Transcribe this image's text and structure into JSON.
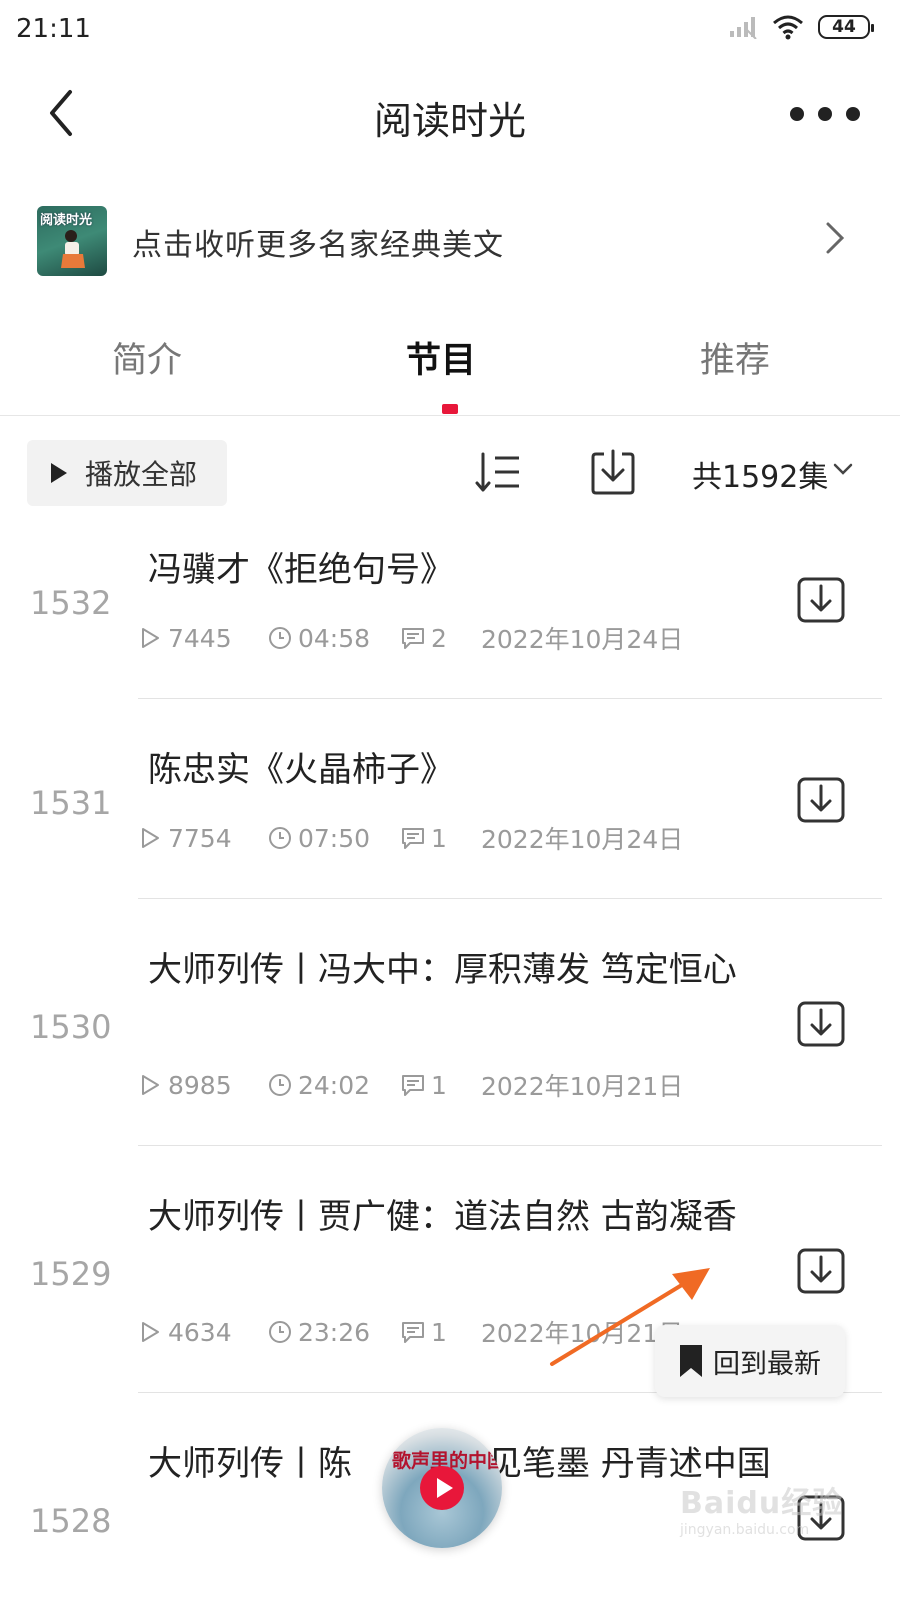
{
  "status_bar": {
    "time": "21:11",
    "battery": "44"
  },
  "header": {
    "title": "阅读时光"
  },
  "promo": {
    "cover_text": "阅读时光",
    "text": "点击收听更多名家经典美文"
  },
  "tabs": [
    {
      "label": "简介",
      "active": false
    },
    {
      "label": "节目",
      "active": true
    },
    {
      "label": "推荐",
      "active": false
    }
  ],
  "toolbar": {
    "play_all_label": "播放全部",
    "count_label": "共1592集"
  },
  "episodes": [
    {
      "num": "1532",
      "title": "冯骥才《拒绝句号》",
      "plays": "7445",
      "duration": "04:58",
      "comments": "2",
      "date": "2022年10月24日"
    },
    {
      "num": "1531",
      "title": "陈忠实《火晶柿子》",
      "plays": "7754",
      "duration": "07:50",
      "comments": "1",
      "date": "2022年10月24日"
    },
    {
      "num": "1530",
      "title": "大师列传丨冯大中：厚积薄发 笃定恒心",
      "plays": "8985",
      "duration": "24:02",
      "comments": "1",
      "date": "2022年10月21日"
    },
    {
      "num": "1529",
      "title": "大师列传丨贾广健：道法自然 古韵凝香",
      "plays": "4634",
      "duration": "23:26",
      "comments": "1",
      "date": "2022年10月21日"
    },
    {
      "num": "1528",
      "title": "大师列传丨陈　　赤诚见笔墨 丹青述中国"
    }
  ],
  "back_to_latest": {
    "label": "回到最新"
  },
  "mini_player": {
    "title": "歌声里的中国"
  },
  "watermark": {
    "text": "Baidu经验",
    "sub": "jingyan.baidu.com"
  },
  "colors": {
    "accent": "#e8173a",
    "annotation_arrow": "#f06a24"
  }
}
